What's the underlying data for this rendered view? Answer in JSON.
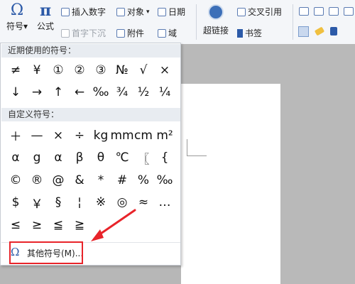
{
  "ribbon": {
    "symbol_label": "符号",
    "formula_label": "公式",
    "insert_number_label": "插入数字",
    "object_label": "对象",
    "date_label": "日期",
    "drop_cap_label": "首字下沉",
    "attachment_label": "附件",
    "field_label": "域",
    "hyperlink_label": "超链接",
    "cross_ref_label": "交叉引用",
    "bookmark_label": "书签",
    "symbol_glyph": "Ω",
    "formula_glyph": "π"
  },
  "panel": {
    "recent_header": "近期使用的符号：",
    "custom_header": "自定义符号：",
    "recent_symbols": [
      "≠",
      "¥",
      "①",
      "②",
      "③",
      "№",
      "√",
      "×",
      "↓",
      "→",
      "↑",
      "←",
      "‰",
      "¾",
      "½",
      "¼"
    ],
    "custom_symbols": [
      "＋",
      "—",
      "×",
      "÷",
      "kg",
      "mm",
      "cm",
      "m²",
      "α",
      "g",
      "α",
      "β",
      "θ",
      "℃",
      "〖",
      "{",
      "©",
      "®",
      "@",
      "&",
      "*",
      "#",
      "%",
      "‰",
      "$",
      "￥",
      "§",
      "¦",
      "※",
      "◎",
      "≈",
      "…",
      "≤",
      "≥",
      "≦",
      "≧"
    ],
    "more_icon": "Ω",
    "more_label": "其他符号(M)..."
  },
  "colors": {
    "accent": "#2c5aa8",
    "highlight_box": "#e8242a",
    "arrow": "#e8242a"
  }
}
